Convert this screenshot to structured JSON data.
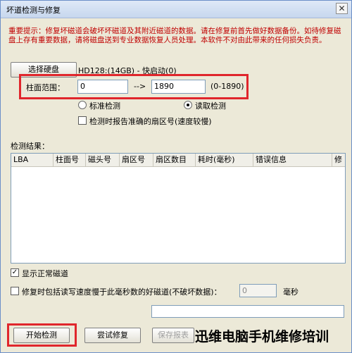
{
  "window": {
    "title": "坏道检测与修复",
    "close_label": "✕"
  },
  "warning": "重要提示：修复坏磁道会破坏坏磁道及其附近磁道的数据。请在修复前首先做好数据备份。如待修复磁盘上存有重要数据，请将磁盘送到专业数据恢复人员处理。本软件不对由此带来的任何损失负责。",
  "disk": {
    "select_button": "选择硬盘",
    "info": "HD128:(14GB) - 快启动(0)"
  },
  "cylinder": {
    "label": "柱面范围：",
    "from": "0",
    "arrow": "-->",
    "to": "1890",
    "range": "(0-1890)"
  },
  "mode": {
    "standard_label": "标准检测",
    "read_label": "读取检测",
    "selected": "read"
  },
  "report_sector": {
    "label": "检测时报告准确的扇区号(速度较慢)",
    "checked": false
  },
  "results": {
    "label": "检测结果：",
    "columns": [
      "LBA",
      "柱面号",
      "磁头号",
      "扇区号",
      "扇区数目",
      "耗时(毫秒)",
      "错误信息",
      "修"
    ]
  },
  "show_normal": {
    "label": "显示正常磁道",
    "checked": true
  },
  "repair_slow": {
    "label": "修复时包括读写速度慢于此毫秒数的好磁道(不破坏数据)：",
    "value": "0",
    "unit": "毫秒",
    "checked": false
  },
  "buttons": {
    "start": "开始检测",
    "try_repair": "尝试修复",
    "save_report": "保存报表"
  },
  "watermark": "迅维电脑手机维修培训"
}
